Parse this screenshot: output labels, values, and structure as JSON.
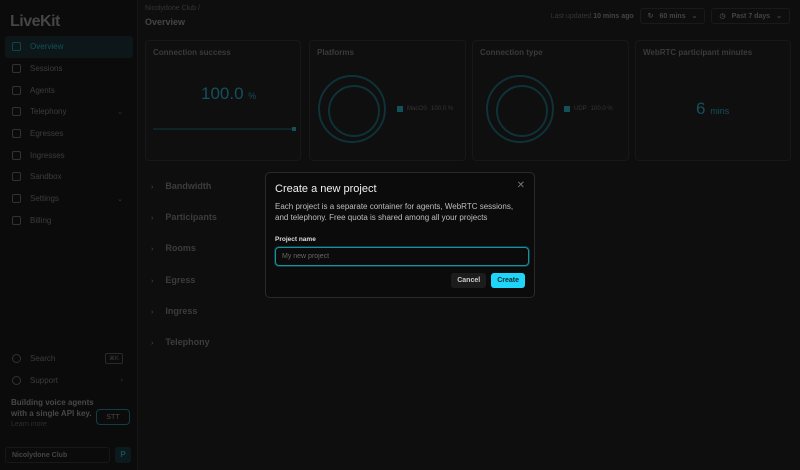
{
  "app": {
    "logo": "LiveKit"
  },
  "sidebar": {
    "items": [
      {
        "label": "Overview",
        "icon": "chart-icon",
        "active": true
      },
      {
        "label": "Sessions",
        "icon": "sessions-icon"
      },
      {
        "label": "Agents",
        "icon": "agents-icon"
      },
      {
        "label": "Telephony",
        "icon": "phone-icon",
        "chevron": true
      },
      {
        "label": "Egresses",
        "icon": "egress-icon"
      },
      {
        "label": "Ingresses",
        "icon": "ingress-icon"
      },
      {
        "label": "Sandbox",
        "icon": "sandbox-icon"
      },
      {
        "label": "Settings",
        "icon": "gear-icon",
        "chevron": true
      },
      {
        "label": "Billing",
        "icon": "billing-icon"
      }
    ],
    "search": "Search",
    "search_kbd": "⌘K",
    "support": "Support",
    "promo": {
      "text": "Building voice agents with a single API key.",
      "link": "Learn more",
      "badge": "STT"
    },
    "project": "Nicolydone Club",
    "avatar": "P"
  },
  "header": {
    "breadcrumb": "Nicolydone Club",
    "separator": "/",
    "title": "Overview",
    "last_updated_prefix": "Last updated",
    "last_updated_value": "10 mins ago",
    "refresh": "60 mins",
    "range": "Past 7 days"
  },
  "cards": {
    "success": {
      "title": "Connection success",
      "value": "100.0",
      "unit": "%"
    },
    "platforms": {
      "title": "Platforms",
      "legend": "MacOS",
      "pct": "100.0 %"
    },
    "conn_type": {
      "title": "Connection type",
      "legend": "UDP",
      "pct": "100.0 %"
    },
    "minutes": {
      "title": "WebRTC participant minutes",
      "value": "6",
      "unit": "mins"
    }
  },
  "sections": [
    "Bandwidth",
    "Participants",
    "Rooms",
    "Egress",
    "Ingress",
    "Telephony"
  ],
  "modal": {
    "title": "Create a new project",
    "description": "Each project is a separate container for agents, WebRTC sessions, and telephony. Free quota is shared among all your projects",
    "label": "Project name",
    "placeholder": "My new project",
    "cancel": "Cancel",
    "create": "Create",
    "close": "✕"
  },
  "colors": {
    "accent": "#1fd5f9"
  }
}
